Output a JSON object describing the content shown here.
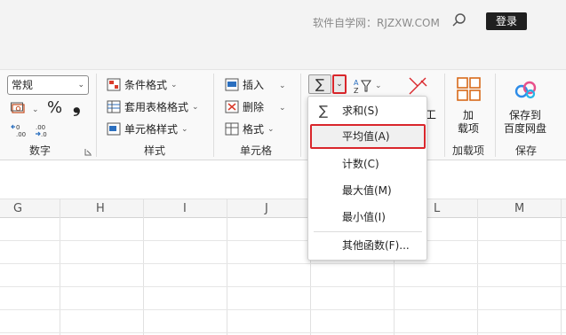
{
  "titlebar": {
    "watermark": "软件自学网：RJZXW.COM",
    "login_label": "登录"
  },
  "ribbon": {
    "number": {
      "format_value": "常规",
      "percent_symbol": "%",
      "comma_symbol": "❟",
      "group_label": "数字"
    },
    "styles": {
      "conditional_format": "条件格式",
      "table_format": "套用表格格式",
      "cell_style": "单元格样式",
      "group_label": "样式"
    },
    "cells": {
      "insert": "插入",
      "delete": "删除",
      "format": "格式",
      "group_label": "单元格"
    },
    "editing": {
      "sum_symbol": "∑",
      "cut_char": "工"
    },
    "addins": {
      "label_line1": "加",
      "label_line2": "载项",
      "group_label": "加载项"
    },
    "save": {
      "label_line1": "保存到",
      "label_line2": "百度网盘",
      "group_label": "保存"
    }
  },
  "dropdown": {
    "items": [
      {
        "label": "求和(S)"
      },
      {
        "label": "平均值(A)"
      },
      {
        "label": "计数(C)"
      },
      {
        "label": "最大值(M)"
      },
      {
        "label": "最小值(I)"
      },
      {
        "label": "其他函数(F)..."
      }
    ]
  },
  "grid": {
    "columns": [
      "G",
      "H",
      "I",
      "J",
      "L",
      "M"
    ]
  },
  "colors": {
    "highlight": "#d9262b",
    "login_bg": "#1f1f1f"
  }
}
